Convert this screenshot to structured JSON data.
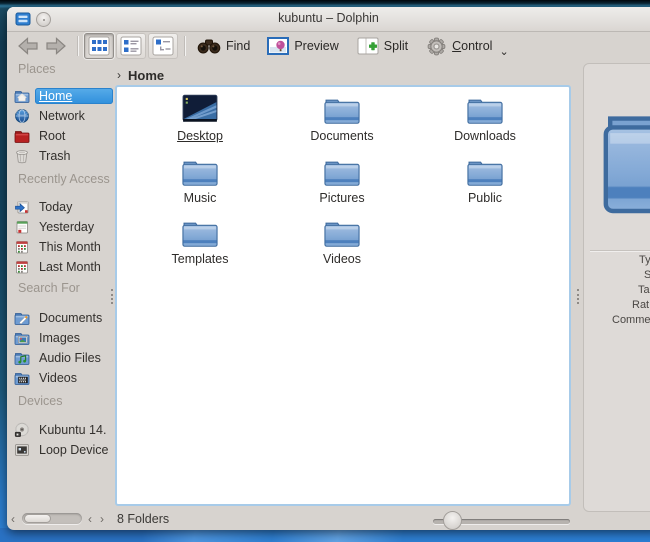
{
  "window": {
    "title": "kubuntu – Dolphin"
  },
  "toolbar": {
    "find_label": "Find",
    "preview_label": "Preview",
    "split_label": "Split",
    "control_accel": "C",
    "control_rest": "ontrol",
    "control_caret": "⌄"
  },
  "breadcrumb": {
    "chevron": "›",
    "label": "Home"
  },
  "sidebar": {
    "sections": [
      {
        "label": "Places",
        "items": [
          {
            "label": "Home",
            "icon": "folder-home-icon",
            "selected": true
          },
          {
            "label": "Network",
            "icon": "globe-network-icon"
          },
          {
            "label": "Root",
            "icon": "folder-red-icon"
          },
          {
            "label": "Trash",
            "icon": "trash-icon"
          }
        ]
      },
      {
        "label": "Recently Access",
        "items": [
          {
            "label": "Today",
            "icon": "calendar-today-icon"
          },
          {
            "label": "Yesterday",
            "icon": "calendar-yesterday-icon"
          },
          {
            "label": "This Month",
            "icon": "calendar-month-icon"
          },
          {
            "label": "Last Month",
            "icon": "calendar-month-icon"
          }
        ]
      },
      {
        "label": "Search For",
        "items": [
          {
            "label": "Documents",
            "icon": "folder-documents-icon"
          },
          {
            "label": "Images",
            "icon": "folder-images-icon"
          },
          {
            "label": "Audio Files",
            "icon": "folder-audio-icon"
          },
          {
            "label": "Videos",
            "icon": "folder-videos-icon"
          }
        ]
      },
      {
        "label": "Devices",
        "items": [
          {
            "label": "Kubuntu 14.",
            "icon": "disc-icon"
          },
          {
            "label": "Loop Device",
            "icon": "drive-icon"
          }
        ]
      }
    ],
    "scrollbar": {
      "left_arrow": "‹",
      "left_arrow2": "‹",
      "right_arrow": "›"
    }
  },
  "main": {
    "folders": [
      {
        "label": "Desktop",
        "icon": "desktop-icon",
        "hovered": true
      },
      {
        "label": "Documents",
        "icon": "folder-icon"
      },
      {
        "label": "Downloads",
        "icon": "folder-icon"
      },
      {
        "label": "Music",
        "icon": "folder-icon"
      },
      {
        "label": "Pictures",
        "icon": "folder-icon"
      },
      {
        "label": "Public",
        "icon": "folder-icon"
      },
      {
        "label": "Templates",
        "icon": "folder-icon"
      },
      {
        "label": "Videos",
        "icon": "folder-icon"
      }
    ]
  },
  "info_panel": {
    "field_labels": [
      "Ty",
      "S",
      "Ta",
      "Rat",
      "Comme"
    ]
  },
  "statusbar": {
    "text": "8 Folders"
  },
  "colors": {
    "selection_blue": "#3f9bdf",
    "view_border_blue": "#a7cbe9",
    "window_gray": "#d7d3cf",
    "folder_blue": "#7fa4d1",
    "wallpaper_blue": "#2c7ed4"
  }
}
